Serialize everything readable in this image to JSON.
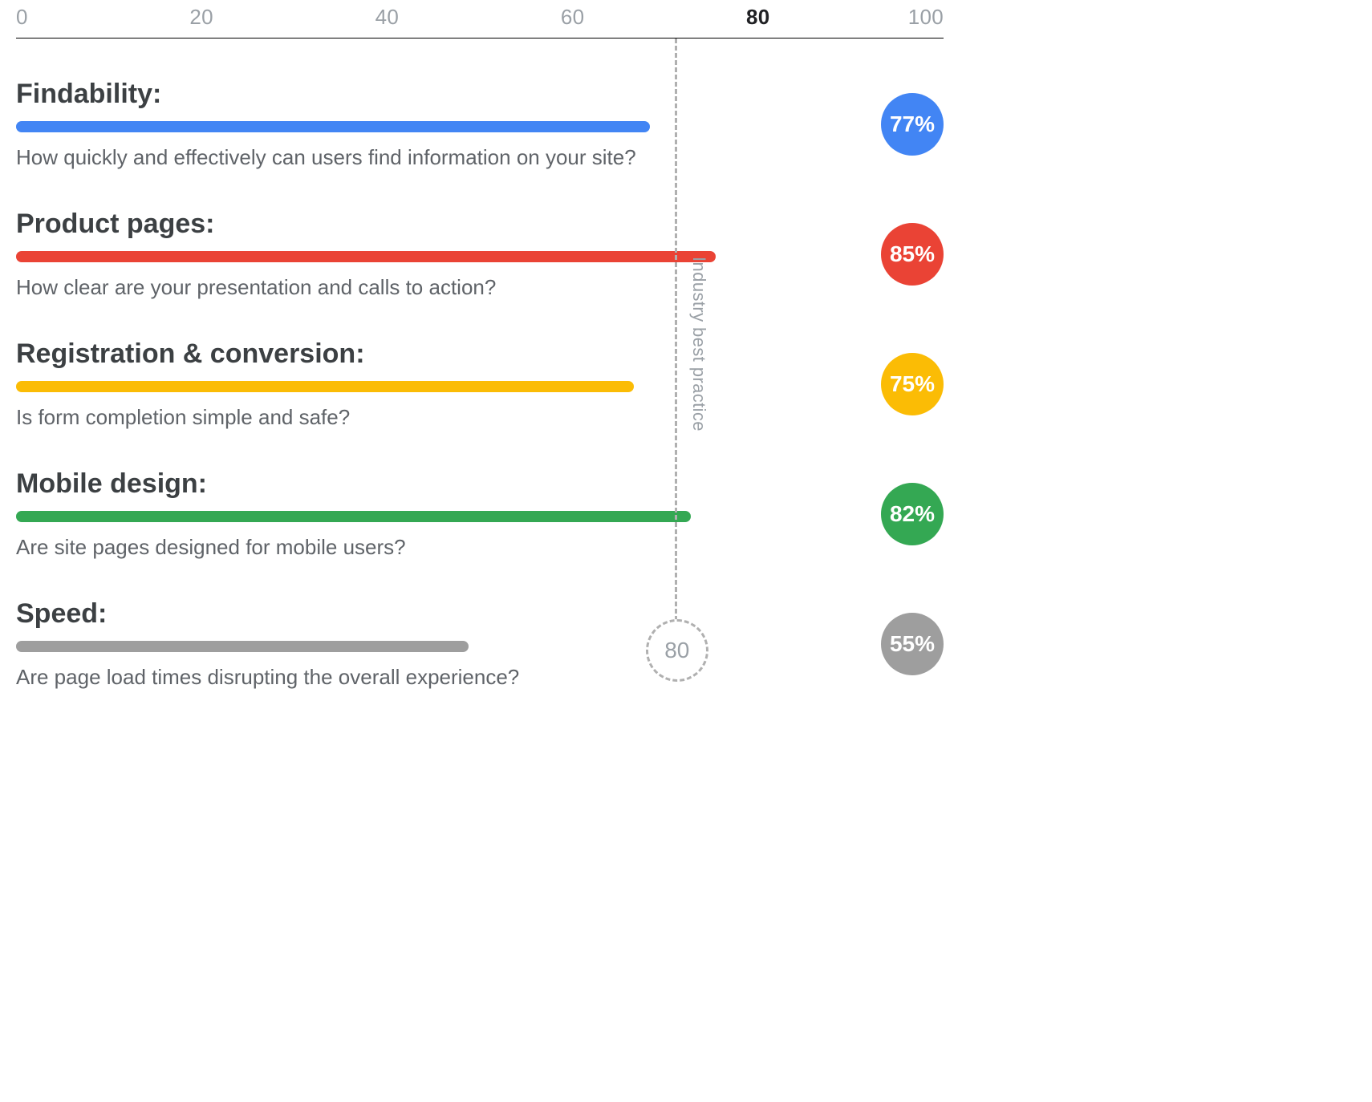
{
  "axis": {
    "ticks": [
      {
        "value": "0",
        "pct": 0,
        "cls": "first"
      },
      {
        "value": "20",
        "pct": 20,
        "cls": ""
      },
      {
        "value": "40",
        "pct": 40,
        "cls": ""
      },
      {
        "value": "60",
        "pct": 60,
        "cls": ""
      },
      {
        "value": "80",
        "pct": 80,
        "cls": "bold"
      },
      {
        "value": "100",
        "pct": 100,
        "cls": "last"
      }
    ]
  },
  "best_practice": {
    "value": 80,
    "label": "Industry best practice",
    "bubble": "80"
  },
  "rows": [
    {
      "id": "findability",
      "title": "Findability:",
      "subtitle": "How quickly and effectively can users find information on your site?",
      "value": 77,
      "value_label": "77%",
      "color": "#4285F4"
    },
    {
      "id": "product-pages",
      "title": "Product pages:",
      "subtitle": "How clear are your presentation and calls to action?",
      "value": 85,
      "value_label": "85%",
      "color": "#EA4335"
    },
    {
      "id": "registration-conversion",
      "title": "Registration & conversion:",
      "subtitle": "Is form completion simple and safe?",
      "value": 75,
      "value_label": "75%",
      "color": "#FBBC05"
    },
    {
      "id": "mobile-design",
      "title": "Mobile design:",
      "subtitle": "Are site pages designed for mobile users?",
      "value": 82,
      "value_label": "82%",
      "color": "#34A853"
    },
    {
      "id": "speed",
      "title": "Speed:",
      "subtitle": "Are page load times disrupting the overall experience?",
      "value": 55,
      "value_label": "55%",
      "color": "#9E9E9E"
    }
  ],
  "chart_data": {
    "type": "bar",
    "orientation": "horizontal",
    "title": "",
    "xlabel": "",
    "ylabel": "",
    "xlim": [
      0,
      100
    ],
    "xticks": [
      0,
      20,
      40,
      60,
      80,
      100
    ],
    "reference_line": {
      "name": "Industry best practice",
      "value": 80
    },
    "categories": [
      "Findability",
      "Product pages",
      "Registration & conversion",
      "Mobile design",
      "Speed"
    ],
    "values": [
      77,
      85,
      75,
      82,
      55
    ],
    "colors": [
      "#4285F4",
      "#EA4335",
      "#FBBC05",
      "#34A853",
      "#9E9E9E"
    ],
    "subtitles": [
      "How quickly and effectively can users find information on your site?",
      "How clear are your presentation and calls to action?",
      "Is form completion simple and safe?",
      "Are site pages designed for mobile users?",
      "Are page load times disrupting the overall experience?"
    ]
  }
}
